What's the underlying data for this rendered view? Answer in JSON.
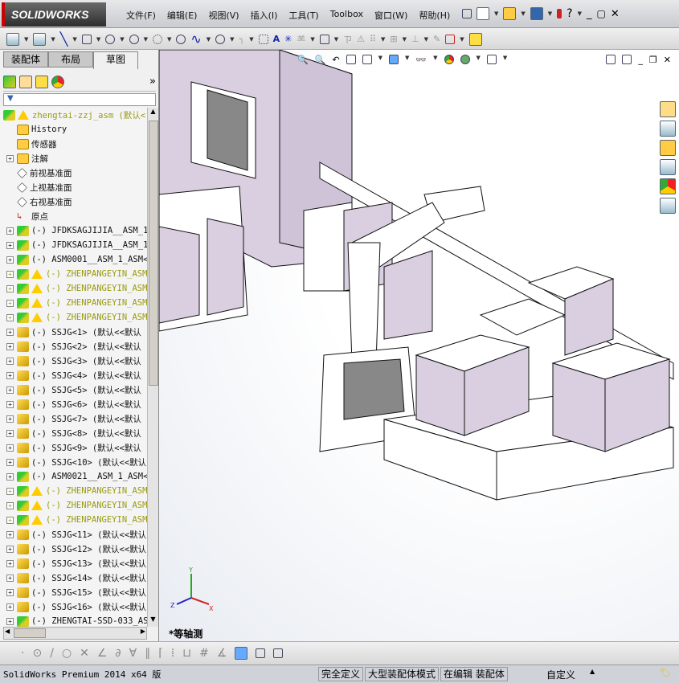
{
  "app": {
    "logo": "SOLIDWORKS"
  },
  "menu": [
    "文件(F)",
    "编辑(E)",
    "视图(V)",
    "插入(I)",
    "工具(T)",
    "Toolbox",
    "窗口(W)",
    "帮助(H)"
  ],
  "tabs": [
    {
      "label": "装配体"
    },
    {
      "label": "布局"
    },
    {
      "label": "草图",
      "active": true
    }
  ],
  "tree": [
    {
      "label": "zhengtai-zzj_asm  (默认<",
      "icon": "assembly",
      "warn": true,
      "root": true
    },
    {
      "label": "History",
      "icon": "history-folder"
    },
    {
      "label": "传感器",
      "icon": "sensor-folder"
    },
    {
      "label": "注解",
      "icon": "annotation-folder",
      "expand": true
    },
    {
      "label": "前视基准面",
      "icon": "plane"
    },
    {
      "label": "上视基准面",
      "icon": "plane"
    },
    {
      "label": "右视基准面",
      "icon": "plane"
    },
    {
      "label": "原点",
      "icon": "origin"
    },
    {
      "label": "(-) JFDKSAGJIJIA__ASM_1",
      "icon": "assembly",
      "expand": true
    },
    {
      "label": "(-) JFDKSAGJIJIA__ASM_1",
      "icon": "assembly",
      "expand": true
    },
    {
      "label": "(-) ASM0001__ASM_1_ASM<",
      "icon": "assembly",
      "expand": true
    },
    {
      "label": "(-) ZHENPANGEYIN_ASM",
      "icon": "assembly",
      "warn": true,
      "expand": true
    },
    {
      "label": "(-) ZHENPANGEYIN_ASM",
      "icon": "assembly",
      "warn": true,
      "expand": true
    },
    {
      "label": "(-) ZHENPANGEYIN_ASM",
      "icon": "assembly",
      "warn": true,
      "expand": true
    },
    {
      "label": "(-) ZHENPANGEYIN_ASM",
      "icon": "assembly",
      "warn": true,
      "expand": true
    },
    {
      "label": "(-) SSJG<1> (默认<<默认",
      "icon": "part",
      "expand": true
    },
    {
      "label": "(-) SSJG<2> (默认<<默认",
      "icon": "part",
      "expand": true
    },
    {
      "label": "(-) SSJG<3> (默认<<默认",
      "icon": "part",
      "expand": true
    },
    {
      "label": "(-) SSJG<4> (默认<<默认",
      "icon": "part",
      "expand": true
    },
    {
      "label": "(-) SSJG<5> (默认<<默认",
      "icon": "part",
      "expand": true
    },
    {
      "label": "(-) SSJG<6> (默认<<默认",
      "icon": "part",
      "expand": true
    },
    {
      "label": "(-) SSJG<7> (默认<<默认",
      "icon": "part",
      "expand": true
    },
    {
      "label": "(-) SSJG<8> (默认<<默认",
      "icon": "part",
      "expand": true
    },
    {
      "label": "(-) SSJG<9> (默认<<默认",
      "icon": "part",
      "expand": true
    },
    {
      "label": "(-) SSJG<10> (默认<<默认",
      "icon": "part",
      "expand": true
    },
    {
      "label": "(-) ASM0021__ASM_1_ASM<",
      "icon": "assembly",
      "expand": true
    },
    {
      "label": "(-) ZHENPANGEYIN_ASM",
      "icon": "assembly",
      "warn": true,
      "expand": true
    },
    {
      "label": "(-) ZHENPANGEYIN_ASM",
      "icon": "assembly",
      "warn": true,
      "expand": true
    },
    {
      "label": "(-) ZHENPANGEYIN_ASM",
      "icon": "assembly",
      "warn": true,
      "expand": true
    },
    {
      "label": "(-) SSJG<11> (默认<<默认",
      "icon": "part",
      "expand": true
    },
    {
      "label": "(-) SSJG<12> (默认<<默认",
      "icon": "part",
      "expand": true
    },
    {
      "label": "(-) SSJG<13> (默认<<默认",
      "icon": "part",
      "expand": true
    },
    {
      "label": "(-) SSJG<14> (默认<<默认",
      "icon": "part",
      "expand": true
    },
    {
      "label": "(-) SSJG<15> (默认<<默认",
      "icon": "part",
      "expand": true
    },
    {
      "label": "(-) SSJG<16> (默认<<默认",
      "icon": "part",
      "expand": true
    },
    {
      "label": "(-) ZHENGTAI-SSD-033_AS",
      "icon": "assembly",
      "expand": true
    }
  ],
  "viewport": {
    "view_name": "*等轴测",
    "triad": {
      "x": "X",
      "y": "Y",
      "z": "Z"
    }
  },
  "status": {
    "product": "SolidWorks Premium 2014 x64 版",
    "definition": "完全定义",
    "mode": "大型装配体模式",
    "editing": "在编辑 装配体",
    "units": "自定义"
  },
  "colors": {
    "model_face": "#d9cfe0",
    "warning_text": "#9a9a10"
  }
}
